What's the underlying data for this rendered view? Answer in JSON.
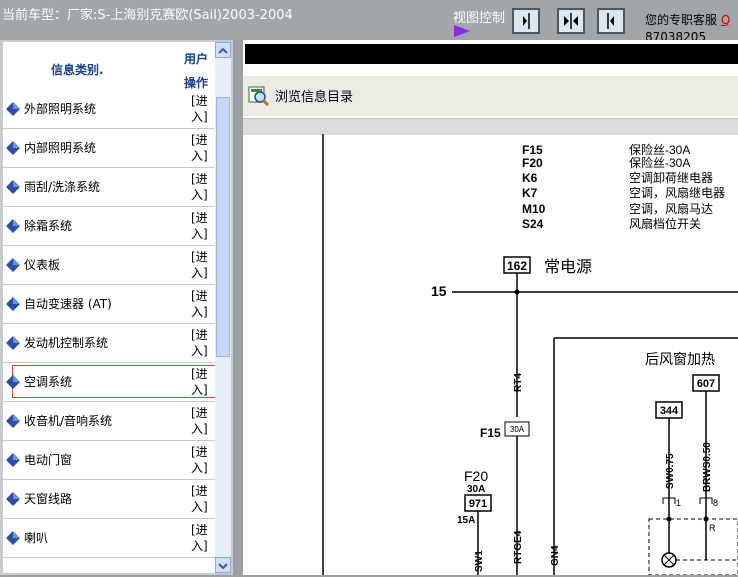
{
  "header": {
    "car_info": "当前车型：厂家:S-上海别克赛欧(Sail)2003-2004",
    "view_control": "视图控制",
    "support_label": "您的专职客服",
    "support_link": "Q",
    "phone": "87038205"
  },
  "left": {
    "col_category": "信息类别.",
    "col_user_1": "用户",
    "col_user_2": "操作",
    "enter_1": "[进",
    "enter_2": "入]",
    "items": [
      "外部照明系统",
      "内部照明系统",
      "雨刮/洗涤系统",
      "除霜系统",
      "仪表板",
      "自动变速器 (AT)",
      "发动机控制系统",
      "空调系统",
      "收音机/音响系统",
      "电动门窗",
      "天窗线路",
      "喇叭"
    ],
    "selected_index": 7
  },
  "right": {
    "browse_label": "浏览信息目录",
    "legend": [
      {
        "code": "F15",
        "desc": "保险丝-30A"
      },
      {
        "code": "F20",
        "desc": "保险丝-30A"
      },
      {
        "code": "K6",
        "desc": "空调卸荷继电器"
      },
      {
        "code": "K7",
        "desc": "空调，风扇继电器"
      },
      {
        "code": "M10",
        "desc": "空调，风扇马达"
      },
      {
        "code": "S24",
        "desc": "风扇档位开关"
      }
    ],
    "diagram": {
      "box_162": "162",
      "const_power": "常电源",
      "rail_15": "15",
      "rt4": "RT4",
      "f15": "F15",
      "f15_amp": "30A",
      "f20": "F20",
      "f20_amp": "30A",
      "box_971": "971",
      "f20_15a": "15A",
      "rear_window": "后风窗加热",
      "box_344": "344",
      "box_607": "607",
      "sw075": "SW0.75",
      "brws050": "BRWS0.50",
      "pin_1": "1",
      "pin_8": "8",
      "pin_r": "R",
      "sw1": "SW1",
      "rtge4": "RTGE4",
      "gn4": "GN4"
    }
  }
}
